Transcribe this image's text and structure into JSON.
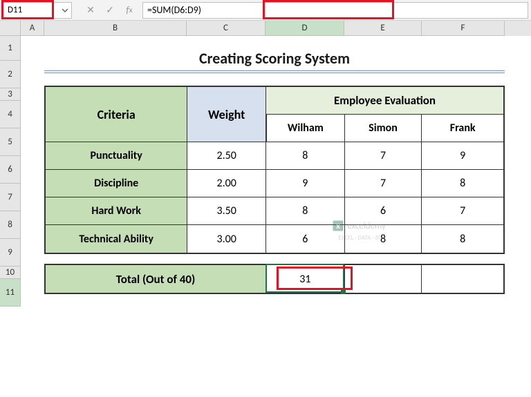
{
  "nameBox": "D11",
  "formula": "=SUM(D6:D9)",
  "columns": [
    "A",
    "B",
    "C",
    "D",
    "E",
    "F"
  ],
  "rowNums": [
    "1",
    "2",
    "3",
    "4",
    "5",
    "6",
    "7",
    "8",
    "9",
    "10",
    "11"
  ],
  "title": "Creating Scoring System",
  "headers": {
    "criteria": "Criteria",
    "weight": "Weight",
    "evaluation": "Employee Evaluation",
    "emp1": "Wilham",
    "emp2": "Simon",
    "emp3": "Frank"
  },
  "rows": [
    {
      "label": "Punctuality",
      "weight": "2.50",
      "d": "8",
      "e": "7",
      "f": "9"
    },
    {
      "label": "Discipline",
      "weight": "2.00",
      "d": "9",
      "e": "7",
      "f": "8"
    },
    {
      "label": "Hard Work",
      "weight": "3.50",
      "d": "8",
      "e": "6",
      "f": "7"
    },
    {
      "label": "Technical Ability",
      "weight": "3.00",
      "d": "6",
      "e": "8",
      "f": "8"
    }
  ],
  "total": {
    "label": "Total (Out of 40)",
    "d": "31",
    "e": "",
    "f": ""
  },
  "watermark": {
    "main": "exceldemy",
    "sub": "EXCEL · DATA · BI"
  },
  "chart_data": {
    "type": "table",
    "title": "Creating Scoring System",
    "columns": [
      "Criteria",
      "Weight",
      "Wilham",
      "Simon",
      "Frank"
    ],
    "rows": [
      [
        "Punctuality",
        2.5,
        8,
        7,
        9
      ],
      [
        "Discipline",
        2.0,
        9,
        7,
        8
      ],
      [
        "Hard Work",
        3.5,
        8,
        6,
        7
      ],
      [
        "Technical Ability",
        3.0,
        6,
        8,
        8
      ]
    ],
    "totals": {
      "label": "Total (Out of 40)",
      "Wilham": 31
    }
  }
}
